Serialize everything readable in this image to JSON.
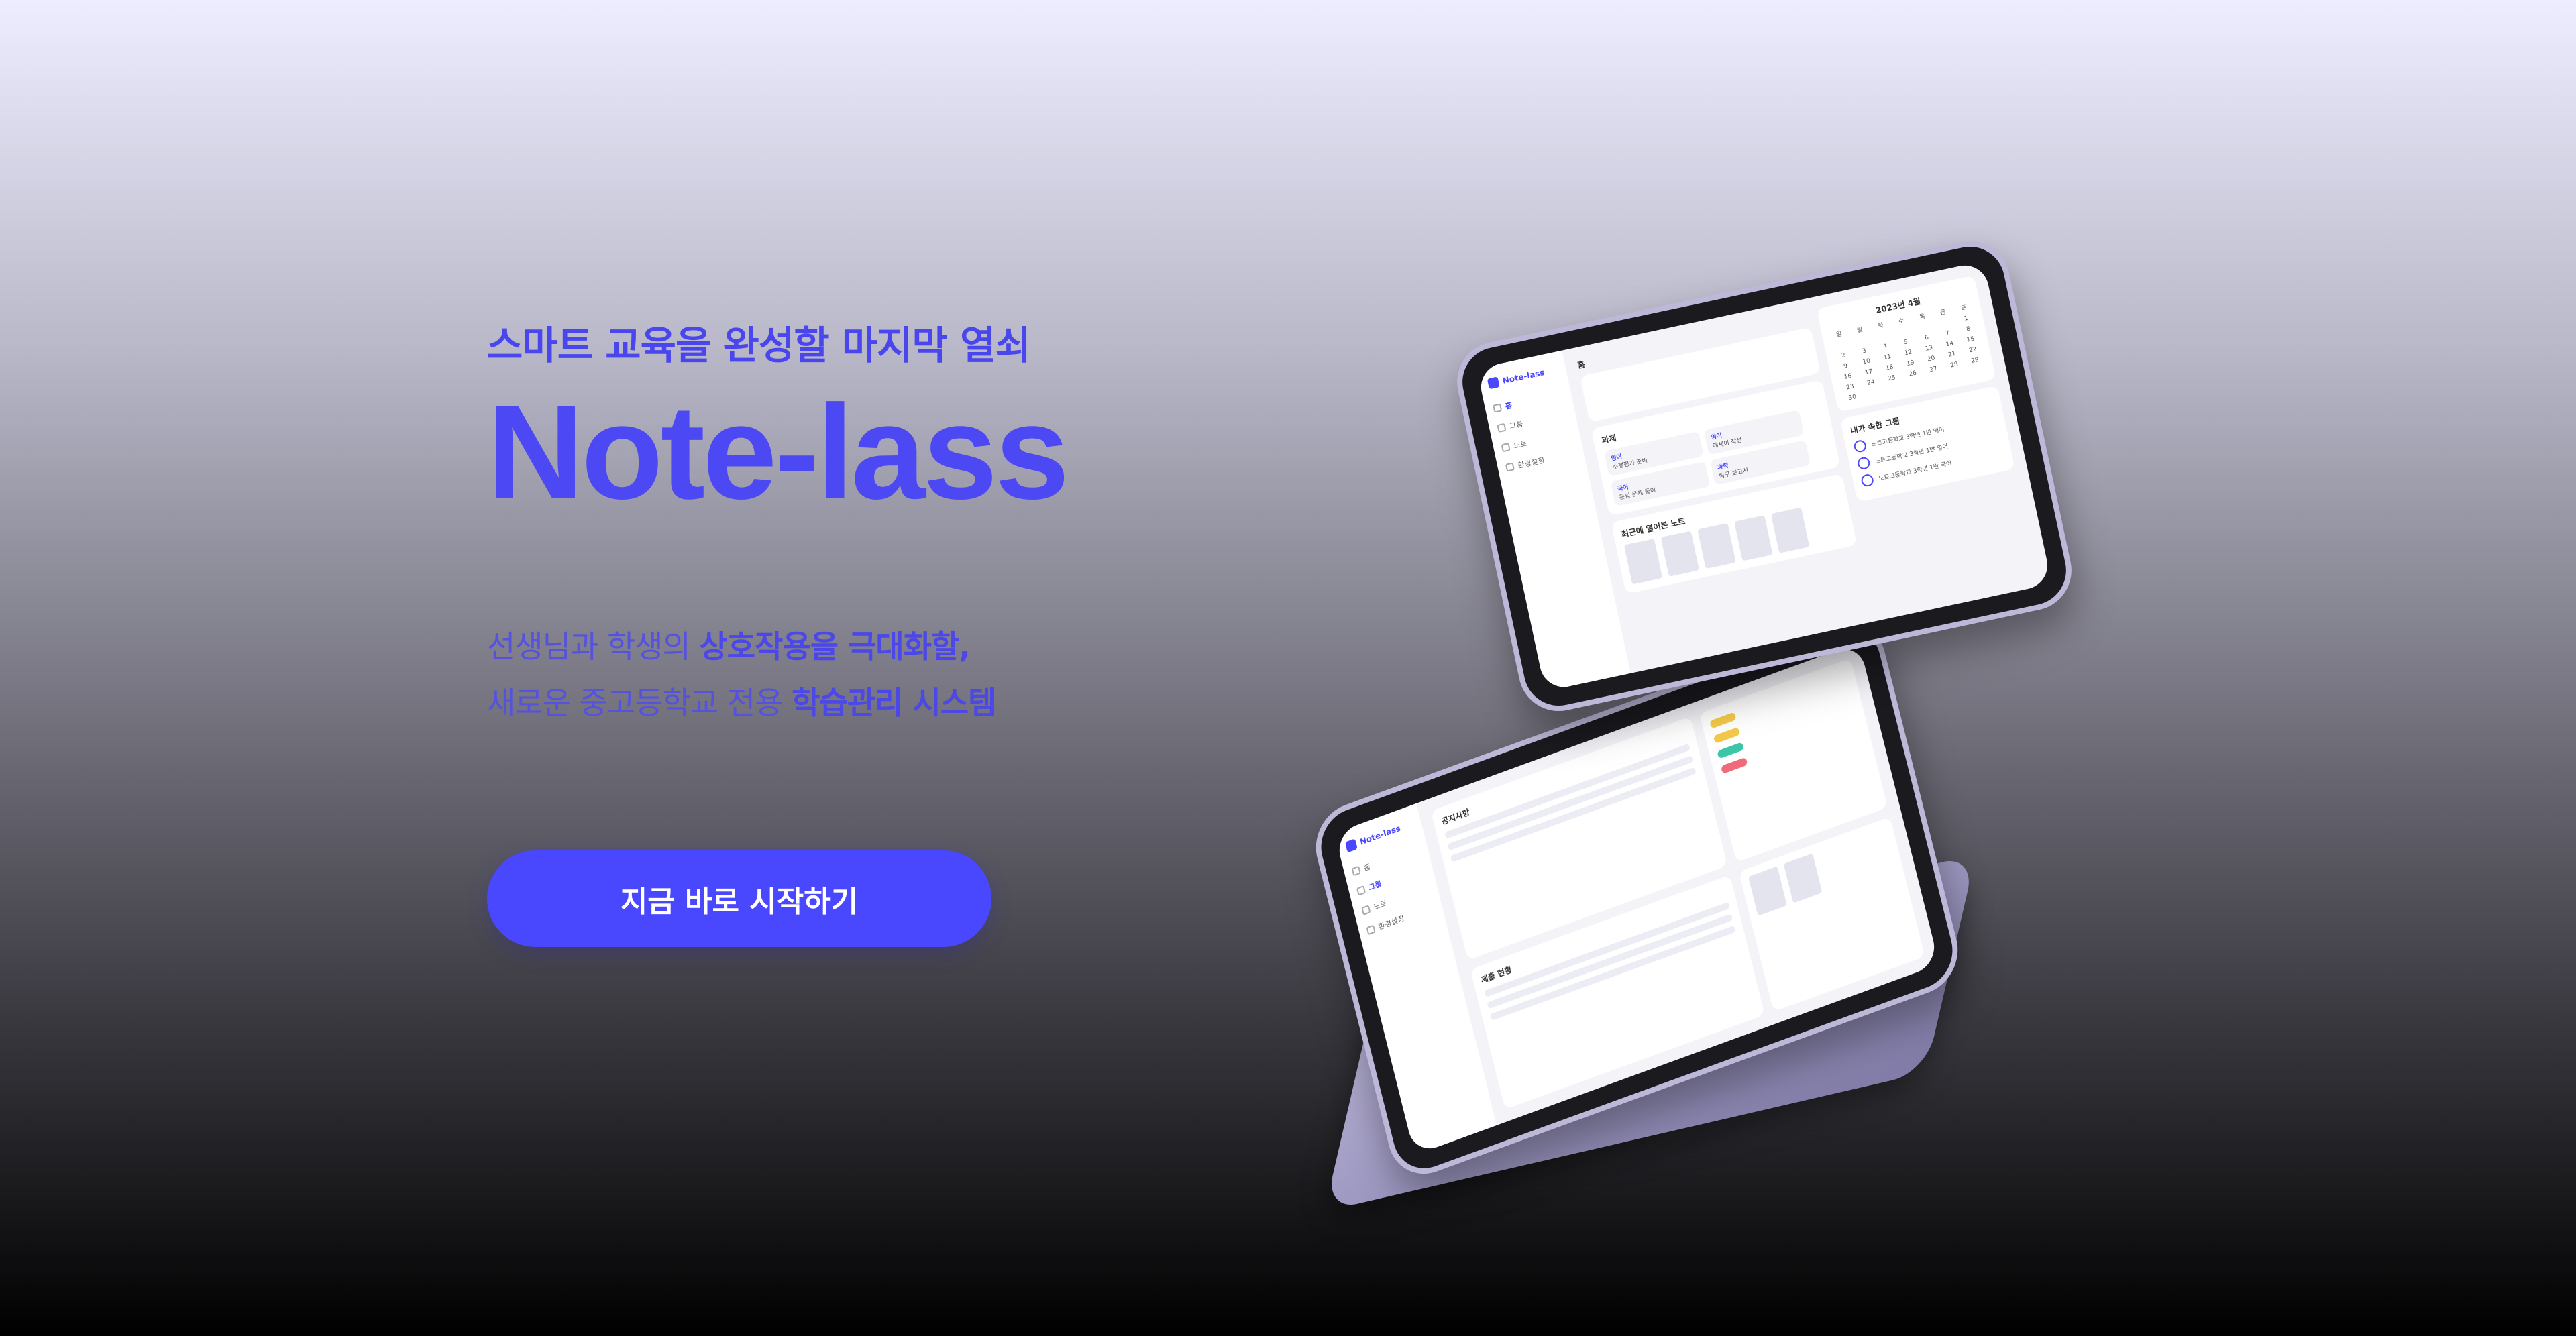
{
  "hero": {
    "subtitle": "스마트 교육을 완성할 마지막 열쇠",
    "brand": "Note-lass",
    "desc_line1_a": "선생님과 학생의 ",
    "desc_line1_b": "상호작용을 극대화할,",
    "desc_line2_a": "새로운 중고등학교 전용 ",
    "desc_line2_b": "학습관리 시스템",
    "cta_label": "지금 바로 시작하기"
  },
  "device_screen": {
    "app_name": "Note-lass",
    "nav": [
      "홈",
      "그룹",
      "노트",
      "환경설정"
    ],
    "page_title": "홈",
    "assignments_title": "과제",
    "assignments": [
      {
        "tag": "영어",
        "title": "수행평가 준비"
      },
      {
        "tag": "영어",
        "title": "에세이 작성"
      },
      {
        "tag": "국어",
        "title": "문법 문제 풀이"
      },
      {
        "tag": "과학",
        "title": "탐구 보고서"
      }
    ],
    "recent_notes_title": "최근에 열어본 노트",
    "calendar_title": "2023년 4월",
    "calendar_days": [
      "일",
      "월",
      "화",
      "수",
      "목",
      "금",
      "토"
    ],
    "calendar_dates": [
      "",
      "",
      "",
      "",
      "",
      "",
      "1",
      "2",
      "3",
      "4",
      "5",
      "6",
      "7",
      "8",
      "9",
      "10",
      "11",
      "12",
      "13",
      "14",
      "15",
      "16",
      "17",
      "18",
      "19",
      "20",
      "21",
      "22",
      "23",
      "24",
      "25",
      "26",
      "27",
      "28",
      "29",
      "30"
    ],
    "groups_title": "내가 속한 그룹",
    "groups": [
      "노트고등학교 3학년 1반 영어",
      "노트고등학교 3학년 1반 영어",
      "노트고등학교 3학년 1반 국어"
    ],
    "back_notice_title": "공지사항",
    "back_status_title": "제출 현황"
  },
  "colors": {
    "accent": "#4a48ff",
    "brand": "#4c49f4",
    "device_frame": "#bdb8d8"
  }
}
